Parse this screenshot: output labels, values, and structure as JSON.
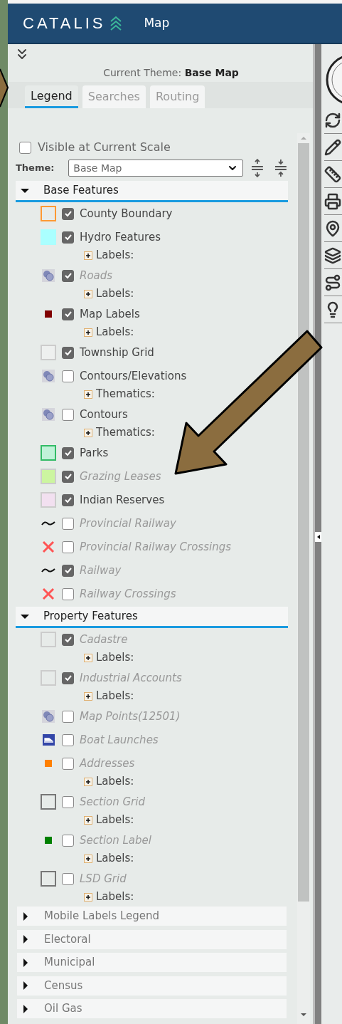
{
  "header": {
    "logo": "CATALIS",
    "title": "Map"
  },
  "panel": {
    "current_theme_label": "Current Theme:",
    "current_theme": "Base Map",
    "tabs": [
      {
        "label": "Legend",
        "selected": true
      },
      {
        "label": "Searches",
        "selected": false
      },
      {
        "label": "Routing",
        "selected": false
      }
    ],
    "visible_at_scale": {
      "label": "Visible at Current Scale",
      "checked": false
    },
    "theme": {
      "label": "Theme:",
      "value": "Base Map"
    },
    "sections": [
      {
        "title": "Base Features",
        "expanded": true,
        "layers": [
          {
            "label": "County Boundary",
            "checked": true,
            "dimmed": false,
            "symbol": {
              "kind": "swatch",
              "outline": {
                "color": "#ff9933"
              }
            }
          },
          {
            "label": "Hydro Features",
            "checked": true,
            "dimmed": false,
            "symbol": {
              "kind": "swatch",
              "color": "#aaffff"
            },
            "sublayers": [
              {
                "label": "Labels:"
              }
            ]
          },
          {
            "label": "Roads",
            "checked": true,
            "dimmed": true,
            "symbol": {
              "kind": "raster"
            },
            "sublayers": [
              {
                "label": "Labels:"
              }
            ]
          },
          {
            "label": "Map Labels",
            "checked": true,
            "dimmed": false,
            "symbol": {
              "kind": "dot",
              "color": "#800000"
            },
            "sublayers": [
              {
                "label": "Labels:"
              }
            ]
          },
          {
            "label": "Township Grid",
            "checked": true,
            "dimmed": false,
            "symbol": {
              "kind": "swatch",
              "color": "#eef0ef",
              "outline": {
                "color": "#cccccc"
              }
            }
          },
          {
            "label": "Contours/Elevations",
            "checked": false,
            "dimmed": false,
            "symbol": {
              "kind": "raster"
            },
            "sublayers": [
              {
                "label": "Thematics:"
              }
            ]
          },
          {
            "label": "Contours",
            "checked": false,
            "dimmed": false,
            "symbol": {
              "kind": "raster"
            },
            "sublayers": [
              {
                "label": "Thematics:"
              }
            ]
          },
          {
            "label": "Parks",
            "checked": true,
            "dimmed": false,
            "symbol": {
              "kind": "swatch",
              "color": "#c0f2d8",
              "outline": {
                "color": "#33bb66"
              }
            }
          },
          {
            "label": "Grazing Leases",
            "checked": true,
            "dimmed": true,
            "symbol": {
              "kind": "swatch",
              "color": "#ccf5a0",
              "outline": {
                "color": "#cccccc"
              }
            }
          },
          {
            "label": "Indian Reserves",
            "checked": true,
            "dimmed": false,
            "symbol": {
              "kind": "swatch",
              "color": "#f2e0f0",
              "outline": {
                "color": "#cccccc"
              }
            }
          },
          {
            "label": "Provincial Railway",
            "checked": false,
            "dimmed": true,
            "symbol": {
              "kind": "line"
            }
          },
          {
            "label": "Provincial Railway Crossings",
            "checked": false,
            "dimmed": true,
            "symbol": {
              "kind": "cross"
            }
          },
          {
            "label": "Railway",
            "checked": true,
            "dimmed": true,
            "symbol": {
              "kind": "line"
            }
          },
          {
            "label": "Railway Crossings",
            "checked": false,
            "dimmed": true,
            "symbol": {
              "kind": "cross"
            }
          }
        ]
      },
      {
        "title": "Property Features",
        "expanded": true,
        "layers": [
          {
            "label": "Cadastre",
            "checked": true,
            "dimmed": true,
            "symbol": {
              "kind": "swatch",
              "outline": {
                "color": "#cccccc"
              }
            },
            "sublayers": [
              {
                "label": "Labels:"
              }
            ]
          },
          {
            "label": "Industrial Accounts",
            "checked": true,
            "dimmed": true,
            "symbol": {
              "kind": "swatch",
              "outline": {
                "color": "#cccccc"
              }
            },
            "sublayers": [
              {
                "label": "Labels:"
              }
            ]
          },
          {
            "label": "Map Points(12501)",
            "checked": false,
            "dimmed": true,
            "symbol": {
              "kind": "raster"
            }
          },
          {
            "label": "Boat Launches",
            "checked": false,
            "dimmed": true,
            "symbol": {
              "kind": "boat"
            }
          },
          {
            "label": "Addresses",
            "checked": false,
            "dimmed": true,
            "symbol": {
              "kind": "dot",
              "color": "#ff8000"
            },
            "sublayers": [
              {
                "label": "Labels:"
              }
            ]
          },
          {
            "label": "Section Grid",
            "checked": false,
            "dimmed": true,
            "symbol": {
              "kind": "swatch",
              "outline": {
                "color": "#777777"
              }
            },
            "sublayers": [
              {
                "label": "Labels:"
              }
            ]
          },
          {
            "label": "Section Label",
            "checked": false,
            "dimmed": true,
            "symbol": {
              "kind": "dot",
              "color": "#008000"
            },
            "sublayers": [
              {
                "label": "Labels:"
              }
            ]
          },
          {
            "label": "LSD Grid",
            "checked": false,
            "dimmed": true,
            "symbol": {
              "kind": "swatch",
              "outline": {
                "color": "#777777"
              }
            },
            "sublayers": [
              {
                "label": "Labels:"
              }
            ]
          }
        ]
      },
      {
        "title": "Mobile Labels Legend",
        "expanded": false
      },
      {
        "title": "Electoral",
        "expanded": false
      },
      {
        "title": "Municipal",
        "expanded": false
      },
      {
        "title": "Census",
        "expanded": false
      },
      {
        "title": "Oil Gas",
        "expanded": false
      }
    ]
  }
}
